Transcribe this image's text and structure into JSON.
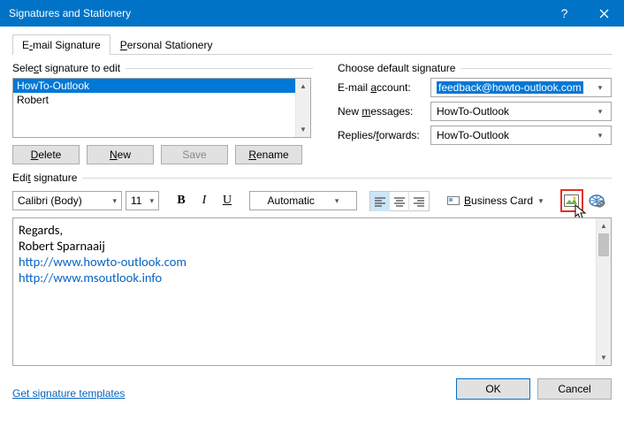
{
  "window": {
    "title": "Signatures and Stationery"
  },
  "tabs": {
    "email_html": "E<u>-</u>mail Signature",
    "stationery_html": "<u>P</u>ersonal Stationery"
  },
  "left": {
    "header_html": "Sele<u>c</u>t signature to edit",
    "items": [
      "HowTo-Outlook",
      "Robert"
    ],
    "buttons": {
      "delete_html": "<u>D</u>elete",
      "new_html": "<u>N</u>ew",
      "save": "Save",
      "rename_html": "<u>R</u>ename"
    }
  },
  "right": {
    "header": "Choose default signature",
    "account_label_html": "E-mail <u>a</u>ccount:",
    "account_value": "feedback@howto-outlook.com",
    "newmsg_label_html": "New <u>m</u>essages:",
    "newmsg_value": "HowTo-Outlook",
    "replies_label_html": "Replies/<u>f</u>orwards:",
    "replies_value": "HowTo-Outlook"
  },
  "edit": {
    "header_html": "Edi<u>t</u> signature",
    "font": "Calibri (Body)",
    "size": "11",
    "color": "Automatic",
    "business_card_html": "<u>B</u>usiness Card",
    "body_line1": "Regards,",
    "body_line2": "Robert Sparnaaij",
    "body_link1": "http://www.howto-outlook.com",
    "body_link2": "http://www.msoutlook.info"
  },
  "footer": {
    "templates_link": "Get signature templates",
    "ok": "OK",
    "cancel": "Cancel"
  }
}
